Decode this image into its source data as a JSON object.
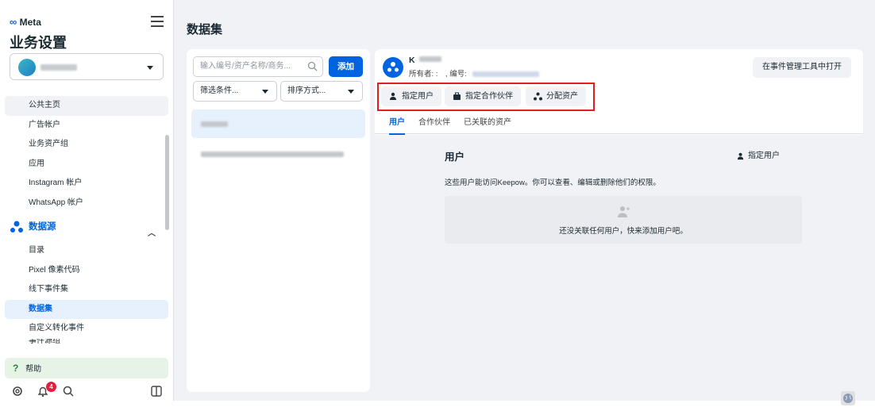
{
  "brand": {
    "logo_text": "Meta"
  },
  "sidebar": {
    "title": "业务设置",
    "nav_items_top": [
      "公共主页",
      "广告帐户",
      "业务资产组",
      "应用",
      "Instagram 帐户",
      "WhatsApp 帐户"
    ],
    "group": {
      "label": "数据源"
    },
    "nav_items_sub": [
      "目录",
      "Pixel 像素代码",
      "线下事件集",
      "数据集",
      "自定义转化事件"
    ],
    "nav_cut_label": "事件源组",
    "active_item": "数据集",
    "help_label": "帮助",
    "notification_count": "4"
  },
  "page": {
    "title": "数据集"
  },
  "list_panel": {
    "search_placeholder": "输入编号/资产名称/商务...",
    "add_label": "添加",
    "filter_label": "筛选条件...",
    "sort_label": "排序方式..."
  },
  "detail": {
    "name": "K",
    "owner_label": "所有者: :     ,",
    "id_label": "编号:",
    "open_button": "在事件管理工具中打开",
    "actions": [
      "指定用户",
      "指定合作伙伴",
      "分配资产"
    ],
    "tabs": [
      "用户",
      "合作伙伴",
      "已关联的资产"
    ],
    "section_title": "用户",
    "section_button": "指定用户",
    "description": "这些用户能访问Keepow。你可以查看、编辑或删除他们的权限。",
    "empty_text": "还没关联任何用户，快来添加用户吧。"
  },
  "colors": {
    "accent": "#0064e0",
    "highlight_box": "#e02020",
    "badge": "#e41e3f"
  }
}
